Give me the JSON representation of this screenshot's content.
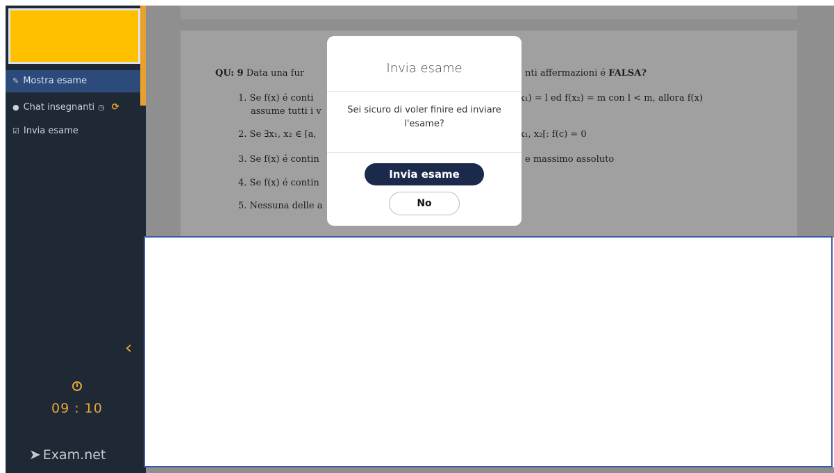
{
  "sidebar": {
    "items": [
      {
        "icon": "edit-icon",
        "label": "Mostra esame"
      },
      {
        "icon": "chat-icon",
        "label": "Chat insegnanti"
      },
      {
        "icon": "check-square-icon",
        "label": "Invia esame"
      }
    ],
    "timer": "09 : 10",
    "brand": "Exam.net"
  },
  "toolbar": {
    "tools": [
      "zoom-in-icon",
      "zoom-out-icon",
      "layout-horizontal-icon",
      "layout-vertical-icon"
    ]
  },
  "question": {
    "label": "QU: 9",
    "stem_left": "Data una fur",
    "stem_right": "nti affermazioni é",
    "stem_bold": "FALSA?",
    "options": [
      {
        "num": "1.",
        "left": "Se f(x) é conti",
        "right": "x₁) = l ed f(x₂) = m con l < m, allora f(x)"
      },
      {
        "num": "",
        "left": "assume tutti i v",
        "right": ""
      },
      {
        "num": "2.",
        "left": "Se ∃x₁, x₂ ∈ [a,",
        "right": "x₁, x₂[: f(c) = 0"
      },
      {
        "num": "3.",
        "left": "Se f(x) é contin",
        "right": "e massimo assoluto"
      },
      {
        "num": "4.",
        "left": "Se f(x) é contin",
        "right": ""
      },
      {
        "num": "5.",
        "left": "Nessuna delle a",
        "right": ""
      }
    ]
  },
  "modal": {
    "title": "Invia esame",
    "body": "Sei sicuro di voler finire ed inviare l'esame?",
    "confirm_label": "Invia esame",
    "cancel_label": "No"
  },
  "colors": {
    "sidebar_bg": "#1f2935",
    "accent": "#e8a02f",
    "logo_yellow": "#ffc000",
    "active_item": "#2c4a7a",
    "primary_button": "#1b2a4a",
    "panel_border": "#3f5ba8"
  }
}
